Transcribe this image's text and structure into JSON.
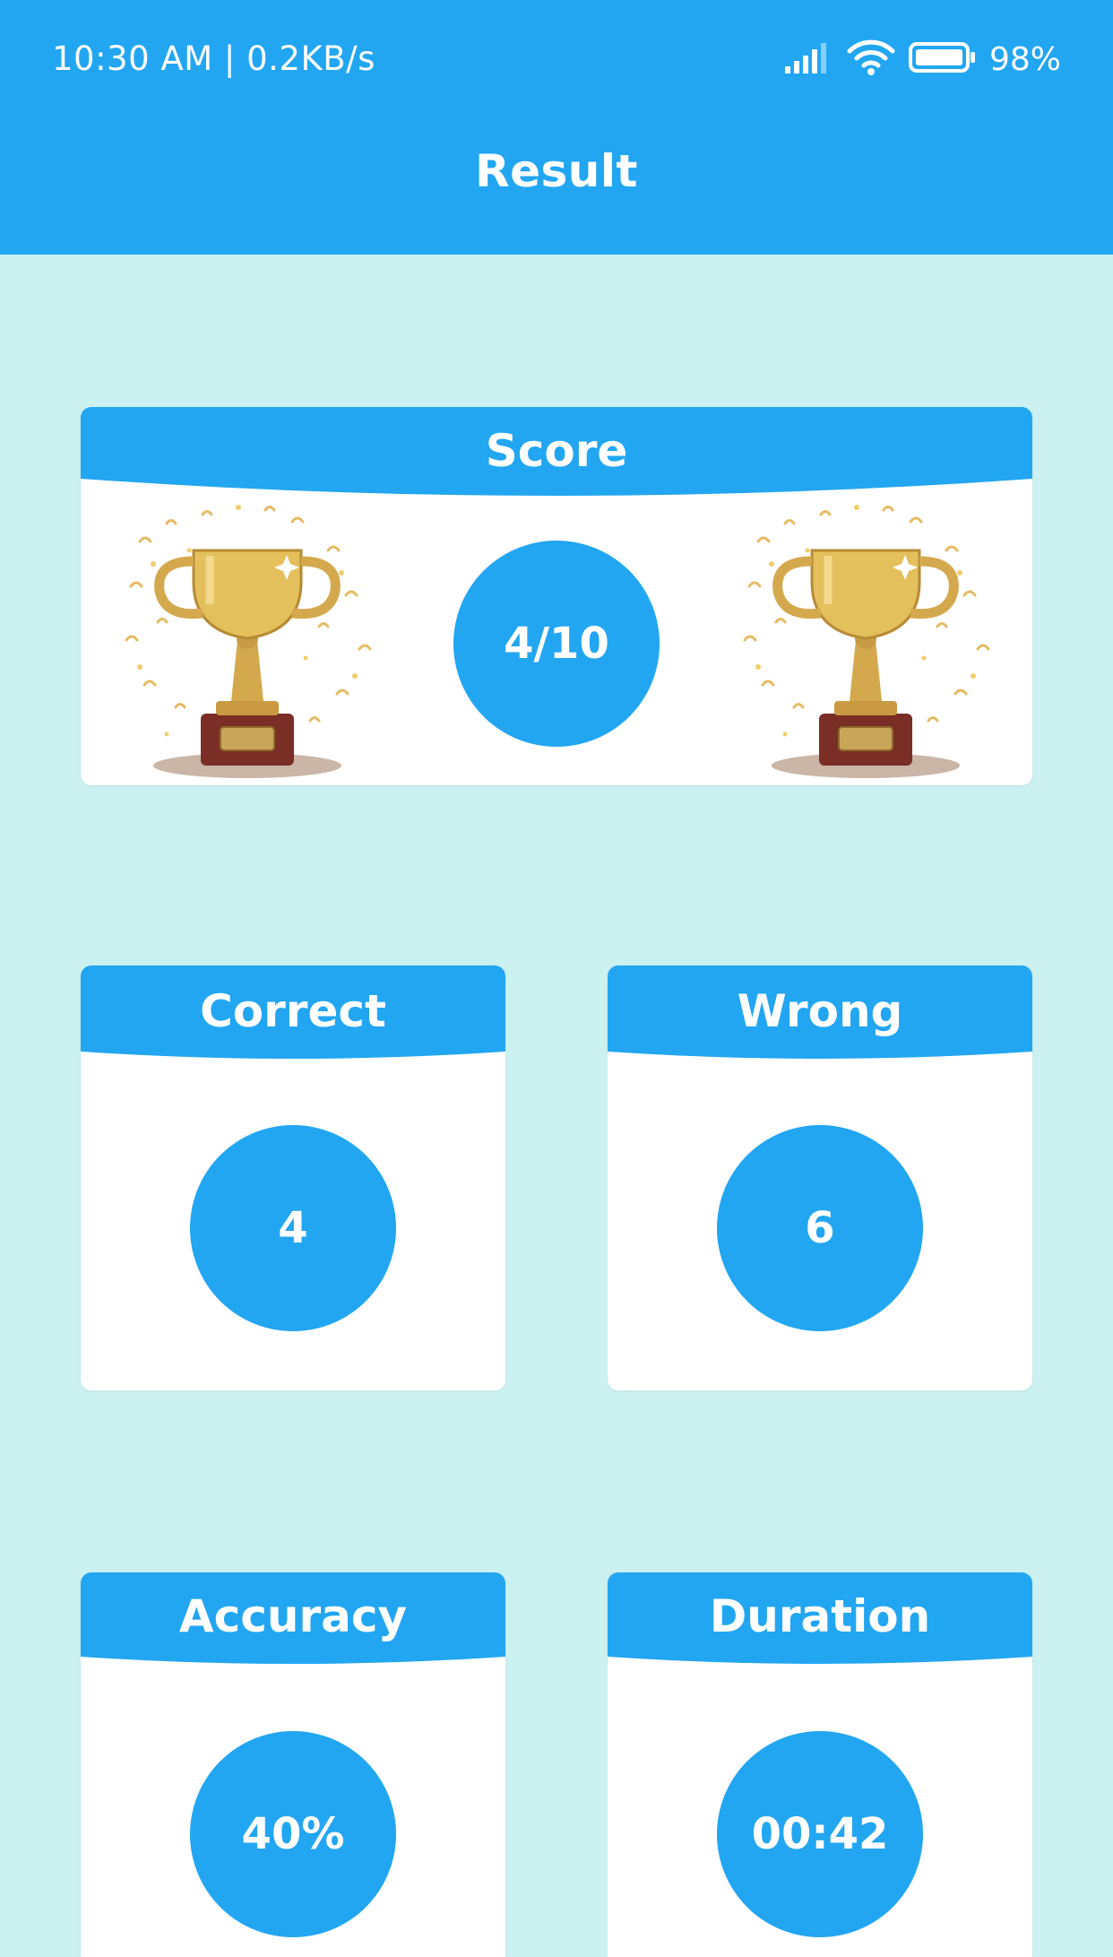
{
  "status_bar": {
    "time_and_speed": "10:30 AM | 0.2KB/s",
    "battery_percent": "98%"
  },
  "header": {
    "title": "Result"
  },
  "score_card": {
    "title": "Score",
    "value": "4/10"
  },
  "correct_card": {
    "title": "Correct",
    "value": "4"
  },
  "wrong_card": {
    "title": "Wrong",
    "value": "6"
  },
  "accuracy_card": {
    "title": "Accuracy",
    "value": "40%"
  },
  "duration_card": {
    "title": "Duration",
    "value": "00:42"
  },
  "icons": [
    "signal-icon",
    "wifi-icon",
    "battery-icon",
    "trophy-icon"
  ],
  "colors": {
    "primary": "#22A6F2",
    "background": "#CCF1F1",
    "card": "#FFFFFF",
    "text_on_primary": "#FFFFFF"
  }
}
